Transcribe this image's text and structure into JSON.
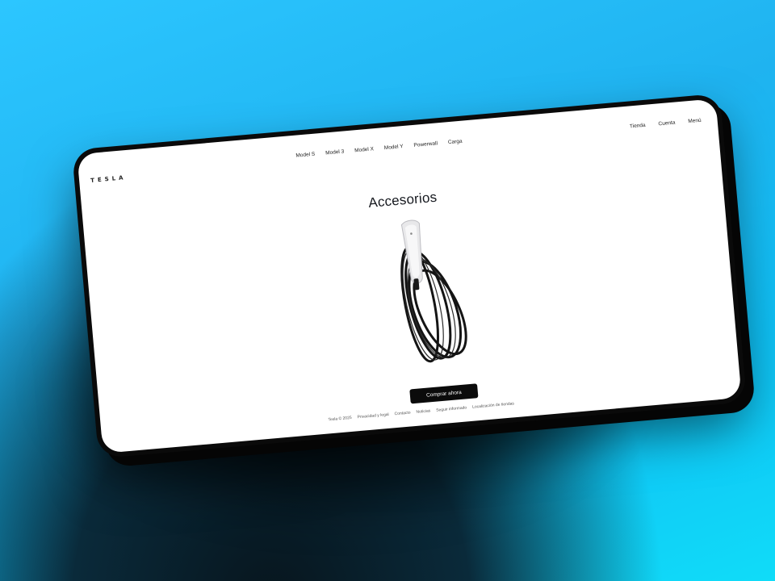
{
  "brand": {
    "logo_text": "TESLA"
  },
  "nav": {
    "items": [
      {
        "label": "Model S"
      },
      {
        "label": "Model 3"
      },
      {
        "label": "Model X"
      },
      {
        "label": "Model Y"
      },
      {
        "label": "Powerwall"
      },
      {
        "label": "Carga"
      }
    ],
    "right": [
      {
        "label": "Tienda"
      },
      {
        "label": "Cuenta"
      },
      {
        "label": "Menú"
      }
    ]
  },
  "hero": {
    "title": "Accesorios",
    "product_icon": "wall-connector-with-cable",
    "cta_label": "Comprar ahora"
  },
  "footer": {
    "items": [
      {
        "label": "Tesla © 2025"
      },
      {
        "label": "Privacidad y legal"
      },
      {
        "label": "Contacto"
      },
      {
        "label": "Noticias"
      },
      {
        "label": "Seguir informado"
      },
      {
        "label": "Localización de tiendas"
      }
    ]
  },
  "colors": {
    "background_top": "#2cc6ff",
    "background_bottom": "#10dcf8",
    "device_frame": "#0a0a0a",
    "screen": "#ffffff",
    "cta_bg": "#0b0b0b",
    "text": "#171a20"
  }
}
